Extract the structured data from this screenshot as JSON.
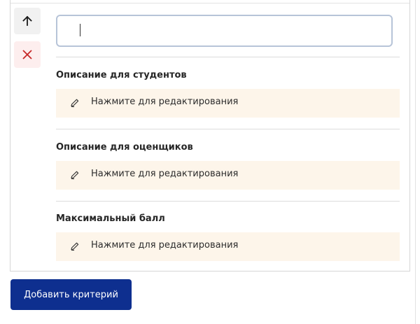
{
  "criterion": {
    "title_value": "",
    "move_up_icon": "arrow-up-icon",
    "delete_icon": "close-icon",
    "sections": [
      {
        "label": "Описание для студентов",
        "placeholder": "Нажмите для редактирования",
        "icon": "pencil-icon"
      },
      {
        "label": "Описание для оценщиков",
        "placeholder": "Нажмите для редактирования",
        "icon": "pencil-icon"
      },
      {
        "label": "Максимальный балл",
        "placeholder": "Нажмите для редактирования",
        "icon": "pencil-icon"
      }
    ]
  },
  "actions": {
    "add_criterion_label": "Добавить критерий"
  },
  "colors": {
    "primary_button": "#0e2f8f",
    "delete_red": "#c62828",
    "edit_box_bg": "#fdf5ea",
    "input_border": "#b7c4d8"
  }
}
